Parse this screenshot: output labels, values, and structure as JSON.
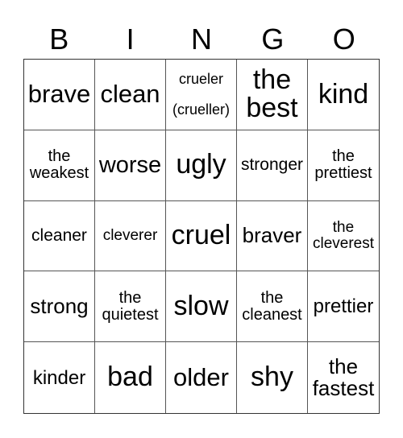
{
  "header": {
    "letters": [
      "B",
      "I",
      "N",
      "G",
      "O"
    ]
  },
  "card": {
    "rows": [
      [
        {
          "lines": [
            "brave"
          ]
        },
        {
          "lines": [
            "clean"
          ]
        },
        {
          "lines": [
            "crueler",
            "(crueller)"
          ]
        },
        {
          "lines": [
            "the",
            "best"
          ]
        },
        {
          "lines": [
            "kind"
          ]
        }
      ],
      [
        {
          "lines": [
            "the",
            "weakest"
          ]
        },
        {
          "lines": [
            "worse"
          ]
        },
        {
          "lines": [
            "ugly"
          ]
        },
        {
          "lines": [
            "stronger"
          ]
        },
        {
          "lines": [
            "the",
            "prettiest"
          ]
        }
      ],
      [
        {
          "lines": [
            "cleaner"
          ]
        },
        {
          "lines": [
            "cleverer"
          ]
        },
        {
          "lines": [
            "cruel"
          ]
        },
        {
          "lines": [
            "braver"
          ]
        },
        {
          "lines": [
            "the",
            "cleverest"
          ]
        }
      ],
      [
        {
          "lines": [
            "strong"
          ]
        },
        {
          "lines": [
            "the",
            "quietest"
          ]
        },
        {
          "lines": [
            "slow"
          ]
        },
        {
          "lines": [
            "the",
            "cleanest"
          ]
        },
        {
          "lines": [
            "prettier"
          ]
        }
      ],
      [
        {
          "lines": [
            "kinder"
          ]
        },
        {
          "lines": [
            "bad"
          ]
        },
        {
          "lines": [
            "older"
          ]
        },
        {
          "lines": [
            "shy"
          ]
        },
        {
          "lines": [
            "the",
            "fastest"
          ]
        }
      ]
    ]
  }
}
